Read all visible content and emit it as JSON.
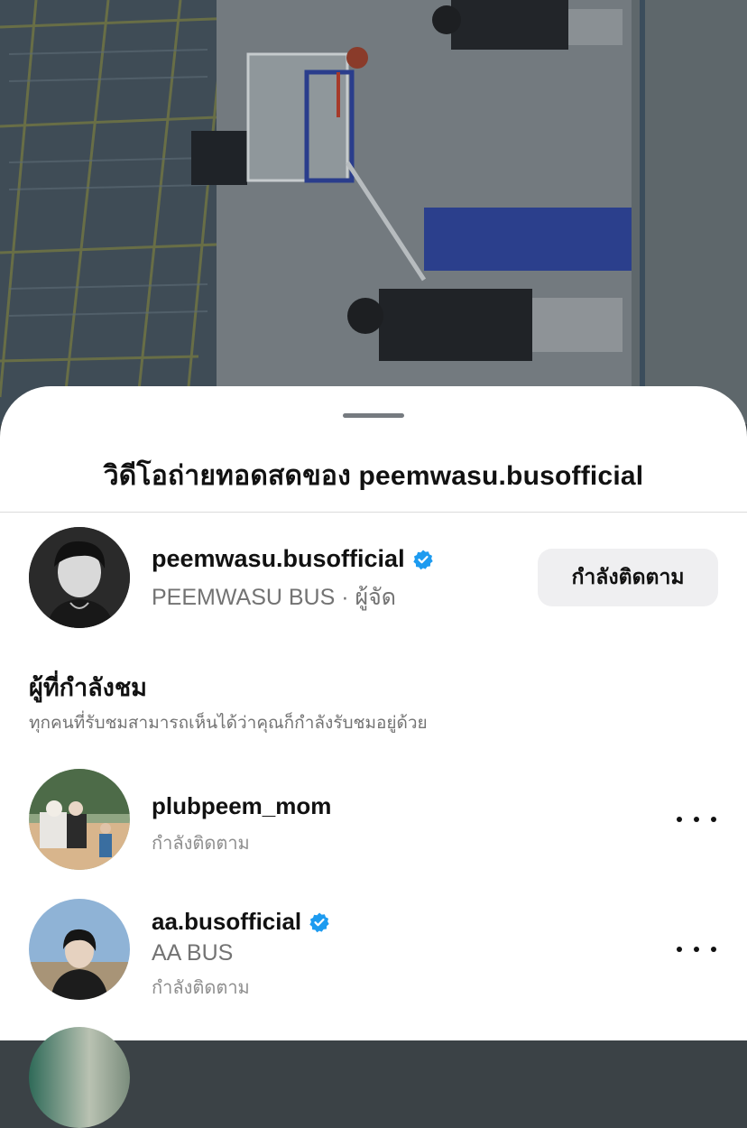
{
  "sheet": {
    "title": "วิดีโอถ่ายทอดสดของ peemwasu.busofficial"
  },
  "host": {
    "username": "peemwasu.busofficial",
    "verified": true,
    "subtitle": "PEEMWASU BUS · ผู้จัด",
    "follow_button": "กำลังติดตาม"
  },
  "viewers_section": {
    "heading": "ผู้ที่กำลังชม",
    "description": "ทุกคนที่รับชมสามารถเห็นได้ว่าคุณก็กำลังรับชมอยู่ด้วย"
  },
  "viewers": [
    {
      "username": "plubpeem_mom",
      "verified": false,
      "full_name": "",
      "status": "กำลังติดตาม"
    },
    {
      "username": "aa.busofficial",
      "verified": true,
      "full_name": "AA BUS",
      "status": "กำลังติดตาม"
    }
  ],
  "icons": {
    "verified": "verified-badge-icon",
    "more": "more-options-icon"
  },
  "colors": {
    "verified_blue": "#1d9bf0",
    "secondary_text": "#737373",
    "follow_button_bg": "#efeff1"
  }
}
